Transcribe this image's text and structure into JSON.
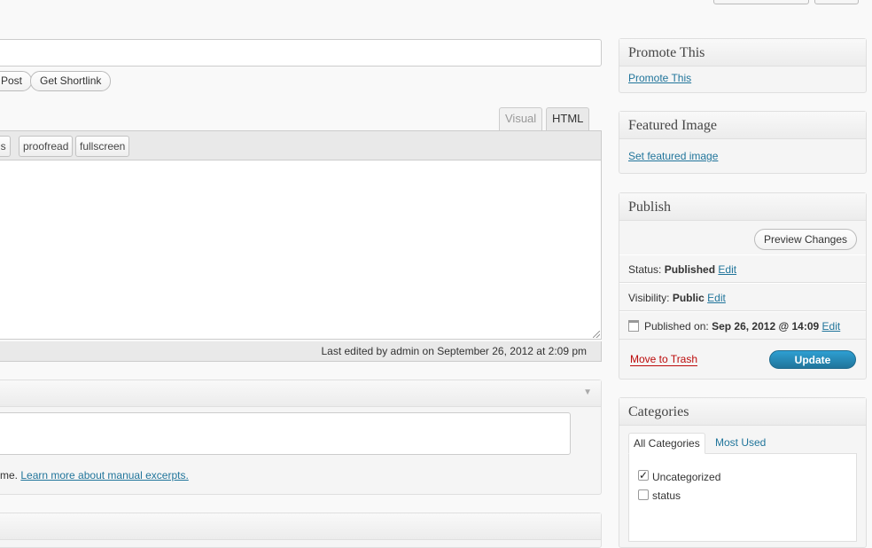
{
  "editor": {
    "buttons": {
      "view_post": "Post",
      "get_shortlink": "Get Shortlink"
    },
    "tabs": {
      "visual": "Visual",
      "html": "HTML"
    },
    "quicktags": [
      "gs",
      "proofread",
      "fullscreen"
    ],
    "last_edited": "Last edited by admin on September 26, 2012 at 2:09 pm"
  },
  "excerpt": {
    "help_prefix": "me. ",
    "help_link": "Learn more about manual excerpts."
  },
  "sidebar": {
    "promote": {
      "title": "Promote This",
      "link": "Promote This"
    },
    "featured": {
      "title": "Featured Image",
      "link": "Set featured image"
    },
    "publish": {
      "title": "Publish",
      "preview": "Preview Changes",
      "status_label": "Status:",
      "status_value": "Published",
      "visibility_label": "Visibility:",
      "visibility_value": "Public",
      "published_label": "Published on:",
      "published_value": "Sep 26, 2012 @ 14:09",
      "edit": "Edit",
      "trash": "Move to Trash",
      "update": "Update"
    },
    "categories": {
      "title": "Categories",
      "tab_all": "All Categories",
      "tab_most_used": "Most Used",
      "items": [
        {
          "label": "Uncategorized",
          "checked": true
        },
        {
          "label": "status",
          "checked": false
        }
      ]
    }
  },
  "colors": {
    "link": "#21759b",
    "trash": "#bc0b0b",
    "update_button": "#21759b"
  }
}
